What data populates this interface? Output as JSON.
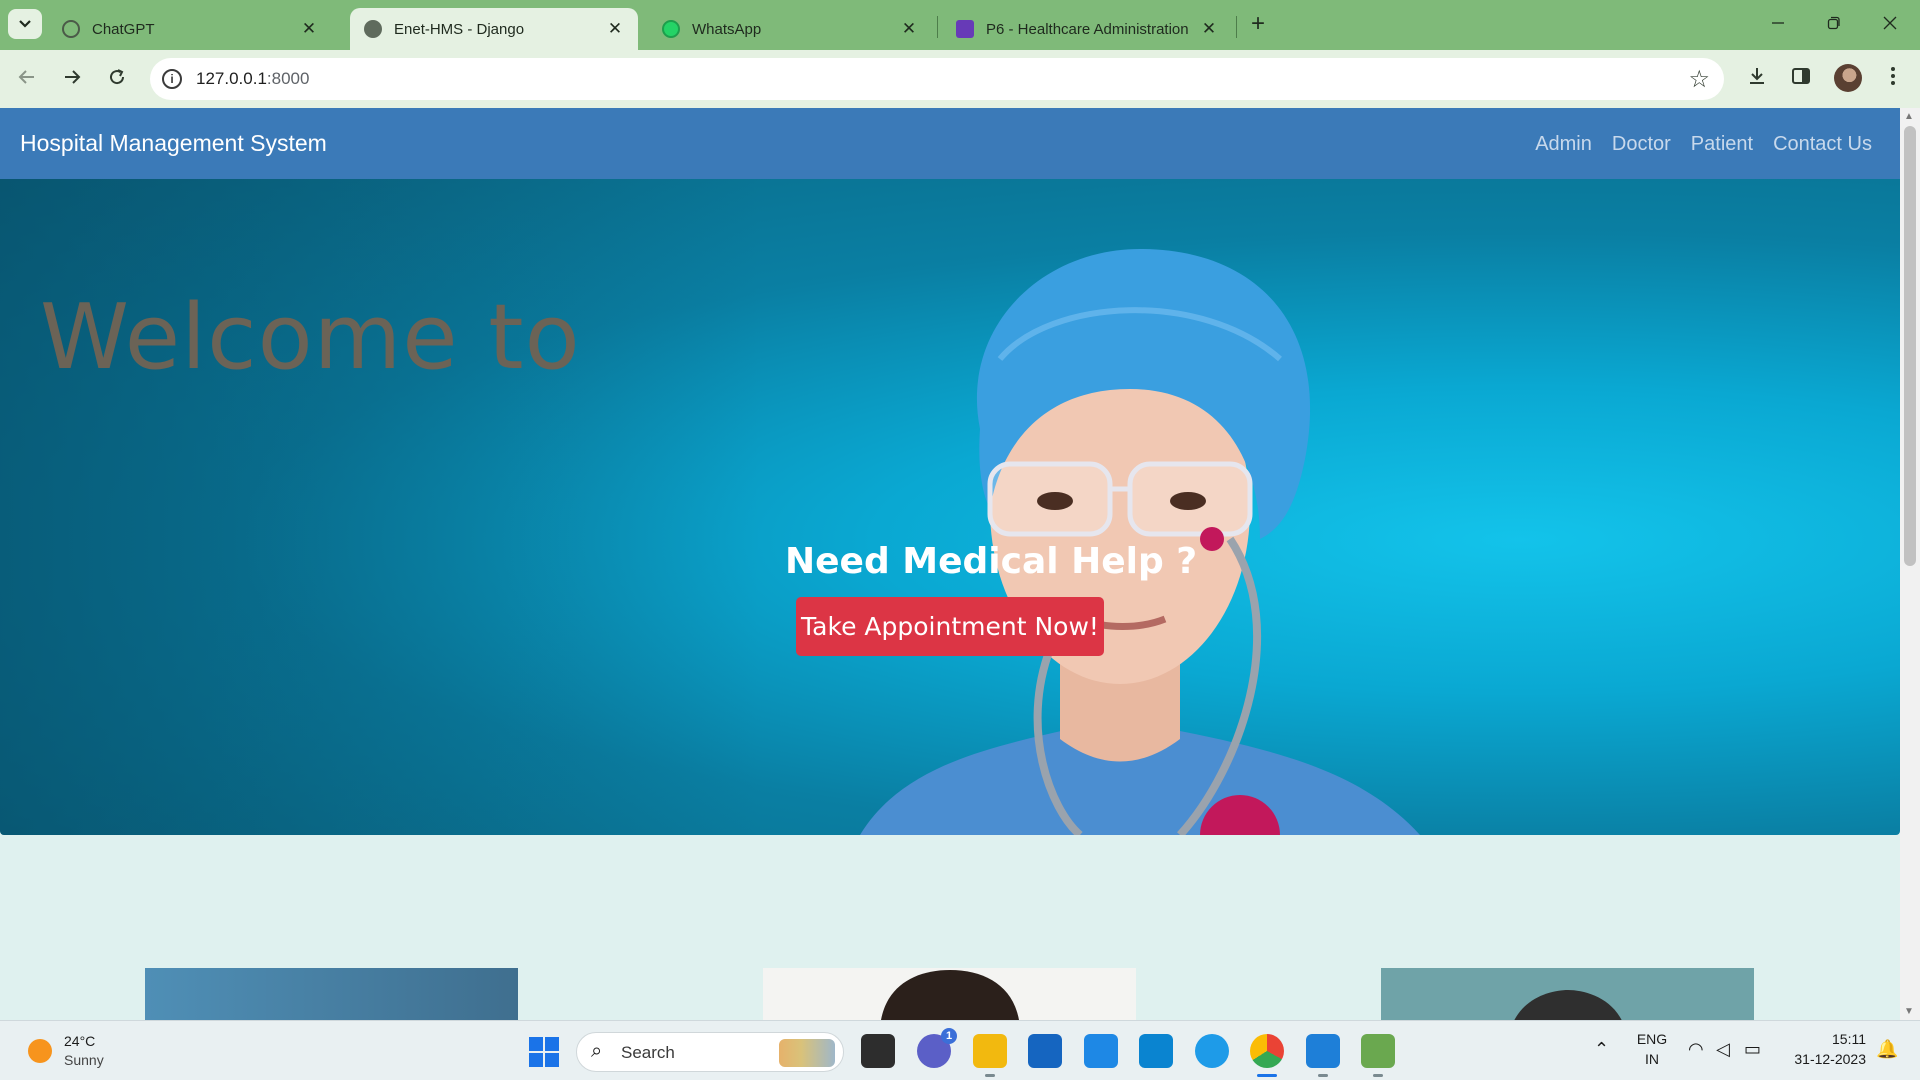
{
  "browser": {
    "tabs": [
      {
        "title": "ChatGPT",
        "active": false,
        "icon": "chatgpt-icon"
      },
      {
        "title": "Enet-HMS - Django",
        "active": true,
        "icon": "globe-icon"
      },
      {
        "title": "WhatsApp",
        "active": false,
        "icon": "whatsapp-icon"
      },
      {
        "title": "P6 - Healthcare Administration",
        "active": false,
        "icon": "forms-icon"
      }
    ],
    "close_glyph": "✕",
    "new_tab_glyph": "+",
    "url_host": "127.0.0.1",
    "url_port": ":8000"
  },
  "site": {
    "brand": "Hospital Management System",
    "nav": [
      "Admin",
      "Doctor",
      "Patient",
      "Contact Us"
    ],
    "hero": {
      "welcome": "Welcome to",
      "title": "Need Medical Help ?",
      "cta": "Take Appointment Now!"
    }
  },
  "taskbar": {
    "weather_temp": "24°C",
    "weather_desc": "Sunny",
    "search_label": "Search",
    "teams_badge": "1",
    "lang_top": "ENG",
    "lang_bottom": "IN",
    "time": "15:11",
    "date": "31-12-2023"
  },
  "colors": {
    "tabbar": "#7fba79",
    "navbar": "#3b7ab8",
    "cta": "#dc3545",
    "hero": "#0aa8d2"
  }
}
